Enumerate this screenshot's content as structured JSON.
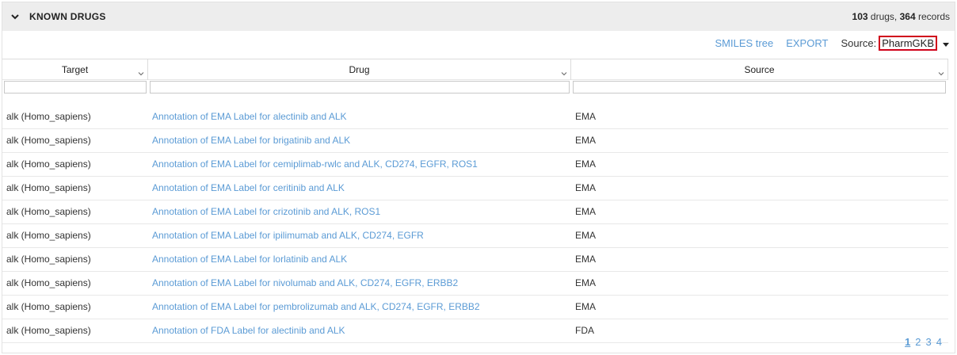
{
  "panel": {
    "title": "KNOWN DRUGS",
    "summary": {
      "drugs_count": "103",
      "drugs_label": "drugs,",
      "records_count": "364",
      "records_label": "records"
    }
  },
  "toolbar": {
    "smiles_tree": "SMILES tree",
    "export": "EXPORT",
    "source_label": "Source:",
    "source_value": "PharmGKB"
  },
  "columns": [
    "Target",
    "Drug",
    "Source"
  ],
  "rows": [
    {
      "target": "alk (Homo_sapiens)",
      "drug": "Annotation of EMA Label for alectinib and ALK",
      "source": "EMA"
    },
    {
      "target": "alk (Homo_sapiens)",
      "drug": "Annotation of EMA Label for brigatinib and ALK",
      "source": "EMA"
    },
    {
      "target": "alk (Homo_sapiens)",
      "drug": "Annotation of EMA Label for cemiplimab-rwlc and ALK, CD274, EGFR, ROS1",
      "source": "EMA"
    },
    {
      "target": "alk (Homo_sapiens)",
      "drug": "Annotation of EMA Label for ceritinib and ALK",
      "source": "EMA"
    },
    {
      "target": "alk (Homo_sapiens)",
      "drug": "Annotation of EMA Label for crizotinib and ALK, ROS1",
      "source": "EMA"
    },
    {
      "target": "alk (Homo_sapiens)",
      "drug": "Annotation of EMA Label for ipilimumab and ALK, CD274, EGFR",
      "source": "EMA"
    },
    {
      "target": "alk (Homo_sapiens)",
      "drug": "Annotation of EMA Label for lorlatinib and ALK",
      "source": "EMA"
    },
    {
      "target": "alk (Homo_sapiens)",
      "drug": "Annotation of EMA Label for nivolumab and ALK, CD274, EGFR, ERBB2",
      "source": "EMA"
    },
    {
      "target": "alk (Homo_sapiens)",
      "drug": "Annotation of EMA Label for pembrolizumab and ALK, CD274, EGFR, ERBB2",
      "source": "EMA"
    },
    {
      "target": "alk (Homo_sapiens)",
      "drug": "Annotation of FDA Label for alectinib and ALK",
      "source": "FDA"
    }
  ],
  "pagination": {
    "pages": [
      "1",
      "2",
      "3",
      "4"
    ],
    "current": "1"
  },
  "colors": {
    "link": "#5b9bd5",
    "header_bg": "#ededed",
    "highlight_border": "#d0021b"
  },
  "icons": {
    "collapse": "chevron-down-icon",
    "sort": "chevron-down-icon",
    "dropdown": "caret-down-icon"
  }
}
